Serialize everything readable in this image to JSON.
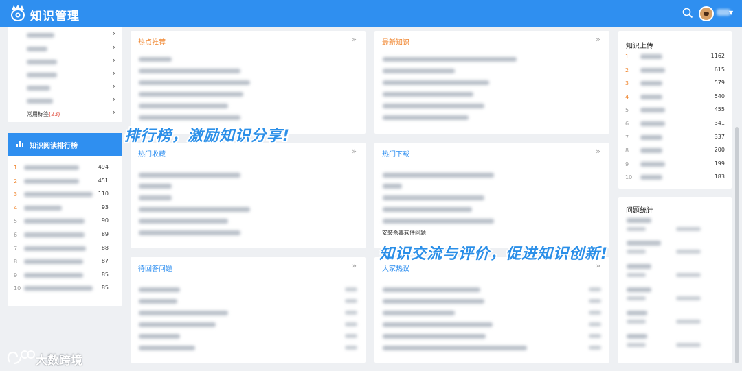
{
  "header": {
    "app_title": "知识管理",
    "logo_icon": "crown-eye-logo",
    "search_icon": "search-icon",
    "brand_color": "#2f8ff0"
  },
  "sidebar": {
    "category_last_label": "常用标签",
    "category_last_count": "(23)"
  },
  "reading_rank": {
    "title": "知识阅读排行榜",
    "values": [
      "494",
      "451",
      "110",
      "93",
      "90",
      "89",
      "88",
      "87",
      "85",
      "85"
    ]
  },
  "panels": {
    "hot_recommend": "热点推荐",
    "latest_knowledge": "最新知识",
    "hot_favorites": "热门收藏",
    "hot_downloads": "热门下载",
    "hot_downloads_visible_item": "安装杀毒软件问题",
    "pending_questions": "待回答问题",
    "discussion": "大家热议",
    "more_symbol": "»"
  },
  "upload_rank": {
    "title": "知识上传",
    "values": [
      "1162",
      "615",
      "579",
      "540",
      "455",
      "341",
      "337",
      "200",
      "199",
      "183"
    ]
  },
  "question_stats": {
    "title": "问题统计"
  },
  "overlays": {
    "slogan1": "排行榜，激励知识分享!",
    "slogan2": "知识交流与评价，促进知识创新!",
    "watermark": "大数跨境"
  },
  "rank_numbers": [
    "1",
    "2",
    "3",
    "4",
    "5",
    "6",
    "7",
    "8",
    "9",
    "10"
  ]
}
